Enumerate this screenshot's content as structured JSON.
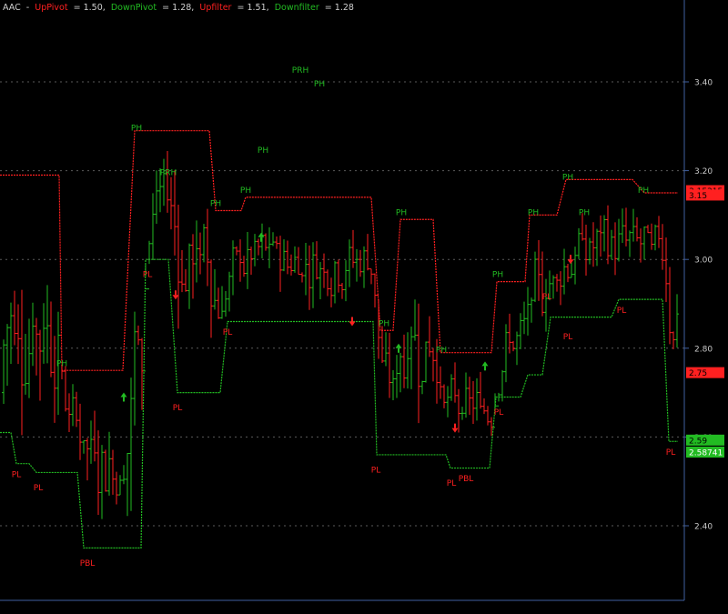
{
  "header": {
    "symbol": "AAC",
    "sep": " - ",
    "parts": [
      {
        "text": "UpPivot",
        "color": "#ff2020"
      },
      {
        "text": " = 1.50, ",
        "color": "#d0d0d0"
      },
      {
        "text": "DownPivot",
        "color": "#22bb22"
      },
      {
        "text": " = 1.28, ",
        "color": "#d0d0d0"
      },
      {
        "text": "Upfilter",
        "color": "#ff2020"
      },
      {
        "text": " = 1.51, ",
        "color": "#d0d0d0"
      },
      {
        "text": "Downfilter",
        "color": "#22bb22"
      },
      {
        "text": " = 1.28",
        "color": "#d0d0d0"
      }
    ]
  },
  "chart_data": {
    "type": "ohlc-bar",
    "ylim": [
      2.35,
      3.45
    ],
    "y_ticks": [
      2.4,
      2.6,
      2.8,
      3.0,
      3.2,
      3.4
    ],
    "y_tick_labels": [
      "2.40",
      "2.60",
      "2.80",
      "3.00",
      "3.20",
      "3.40"
    ],
    "grid": true,
    "colors": {
      "up": "#22bb22",
      "down": "#ff2020",
      "grid": "#5a5a5a",
      "frame": "#4060a0"
    },
    "price_tags": [
      {
        "label": "3.15315",
        "value": 3.155,
        "bg": "#ff2020",
        "fg": "#000000"
      },
      {
        "label": "3.15",
        "value": 3.145,
        "bg": "#ff2020",
        "fg": "#000000"
      },
      {
        "label": "2.75",
        "value": 2.745,
        "bg": "#ff2020",
        "fg": "#000000"
      },
      {
        "label": "2.59",
        "value": 2.593,
        "bg": "#22bb22",
        "fg": "#000000"
      },
      {
        "label": "2.58741",
        "value": 2.566,
        "bg": "#22bb22",
        "fg": "#ffffff"
      }
    ],
    "upper_pivot_line": [
      [
        0,
        3.19
      ],
      [
        65,
        3.19
      ],
      [
        68,
        2.75
      ],
      [
        135,
        2.75
      ],
      [
        148,
        3.29
      ],
      [
        230,
        3.29
      ],
      [
        237,
        3.11
      ],
      [
        265,
        3.11
      ],
      [
        270,
        3.14
      ],
      [
        408,
        3.14
      ],
      [
        418,
        2.84
      ],
      [
        432,
        2.84
      ],
      [
        440,
        3.09
      ],
      [
        476,
        3.09
      ],
      [
        484,
        2.79
      ],
      [
        540,
        2.79
      ],
      [
        546,
        2.95
      ],
      [
        577,
        2.95
      ],
      [
        582,
        3.1
      ],
      [
        612,
        3.1
      ],
      [
        622,
        3.18
      ],
      [
        695,
        3.18
      ],
      [
        708,
        3.15
      ],
      [
        745,
        3.15
      ]
    ],
    "lower_pivot_line": [
      [
        0,
        2.61
      ],
      [
        12,
        2.61
      ],
      [
        18,
        2.54
      ],
      [
        32,
        2.54
      ],
      [
        40,
        2.52
      ],
      [
        85,
        2.52
      ],
      [
        92,
        2.35
      ],
      [
        155,
        2.35
      ],
      [
        160,
        3.0
      ],
      [
        185,
        3.0
      ],
      [
        195,
        2.7
      ],
      [
        242,
        2.7
      ],
      [
        250,
        2.86
      ],
      [
        410,
        2.86
      ],
      [
        414,
        2.56
      ],
      [
        490,
        2.56
      ],
      [
        495,
        2.53
      ],
      [
        538,
        2.53
      ],
      [
        545,
        2.69
      ],
      [
        572,
        2.69
      ],
      [
        580,
        2.74
      ],
      [
        596,
        2.74
      ],
      [
        605,
        2.87
      ],
      [
        672,
        2.87
      ],
      [
        680,
        2.91
      ],
      [
        728,
        2.91
      ],
      [
        735,
        2.59
      ],
      [
        745,
        2.59
      ]
    ],
    "labels": [
      {
        "text": "PL",
        "x": 18,
        "value": 2.51,
        "color": "#ff2020"
      },
      {
        "text": "PL",
        "x": 42,
        "value": 2.48,
        "color": "#ff2020"
      },
      {
        "text": "PH",
        "x": 68,
        "value": 2.76,
        "color": "#22bb22"
      },
      {
        "text": "PBL",
        "x": 96,
        "value": 2.31,
        "color": "#ff2020"
      },
      {
        "text": "PH",
        "x": 150,
        "value": 3.29,
        "color": "#22bb22"
      },
      {
        "text": "PL",
        "x": 162,
        "value": 2.96,
        "color": "#ff2020"
      },
      {
        "text": "PRH",
        "x": 185,
        "value": 3.19,
        "color": "#22bb22"
      },
      {
        "text": "PL",
        "x": 195,
        "value": 2.66,
        "color": "#ff2020"
      },
      {
        "text": "PH",
        "x": 237,
        "value": 3.12,
        "color": "#22bb22"
      },
      {
        "text": "PL",
        "x": 250,
        "value": 2.83,
        "color": "#ff2020"
      },
      {
        "text": "PH",
        "x": 270,
        "value": 3.15,
        "color": "#22bb22"
      },
      {
        "text": "PH",
        "x": 289,
        "value": 3.24,
        "color": "#22bb22"
      },
      {
        "text": "PRH",
        "x": 330,
        "value": 3.42,
        "color": "#22bb22"
      },
      {
        "text": "PH",
        "x": 351,
        "value": 3.39,
        "color": "#22bb22"
      },
      {
        "text": "PL",
        "x": 413,
        "value": 2.52,
        "color": "#ff2020"
      },
      {
        "text": "PH",
        "x": 422,
        "value": 2.85,
        "color": "#22bb22"
      },
      {
        "text": "PH",
        "x": 441,
        "value": 3.1,
        "color": "#22bb22"
      },
      {
        "text": "PH",
        "x": 485,
        "value": 2.79,
        "color": "#22bb22"
      },
      {
        "text": "PL",
        "x": 496,
        "value": 2.49,
        "color": "#ff2020"
      },
      {
        "text": "PBL",
        "x": 512,
        "value": 2.5,
        "color": "#ff2020"
      },
      {
        "text": "PH",
        "x": 547,
        "value": 2.96,
        "color": "#22bb22"
      },
      {
        "text": "PL",
        "x": 548,
        "value": 2.65,
        "color": "#ff2020"
      },
      {
        "text": "PH",
        "x": 586,
        "value": 3.1,
        "color": "#22bb22"
      },
      {
        "text": "PL",
        "x": 601,
        "value": 2.91,
        "color": "#ff2020"
      },
      {
        "text": "PH",
        "x": 624,
        "value": 3.18,
        "color": "#22bb22"
      },
      {
        "text": "PH",
        "x": 642,
        "value": 3.1,
        "color": "#22bb22"
      },
      {
        "text": "PL",
        "x": 624,
        "value": 2.82,
        "color": "#ff2020"
      },
      {
        "text": "PL",
        "x": 683,
        "value": 2.88,
        "color": "#ff2020"
      },
      {
        "text": "PH",
        "x": 707,
        "value": 3.15,
        "color": "#22bb22"
      },
      {
        "text": "PL",
        "x": 737,
        "value": 2.56,
        "color": "#ff2020"
      }
    ],
    "arrows": [
      {
        "dir": "up",
        "x": 136,
        "value": 2.69,
        "color": "#22bb22"
      },
      {
        "dir": "down",
        "x": 193,
        "value": 2.92,
        "color": "#ff2020"
      },
      {
        "dir": "up",
        "x": 287,
        "value": 3.05,
        "color": "#22bb22"
      },
      {
        "dir": "down",
        "x": 387,
        "value": 2.86,
        "color": "#ff2020"
      },
      {
        "dir": "up",
        "x": 438,
        "value": 2.8,
        "color": "#22bb22"
      },
      {
        "dir": "down",
        "x": 500,
        "value": 2.62,
        "color": "#ff2020"
      },
      {
        "dir": "up",
        "x": 533,
        "value": 2.76,
        "color": "#22bb22"
      },
      {
        "dir": "down",
        "x": 627,
        "value": 3.0,
        "color": "#ff2020"
      }
    ]
  }
}
